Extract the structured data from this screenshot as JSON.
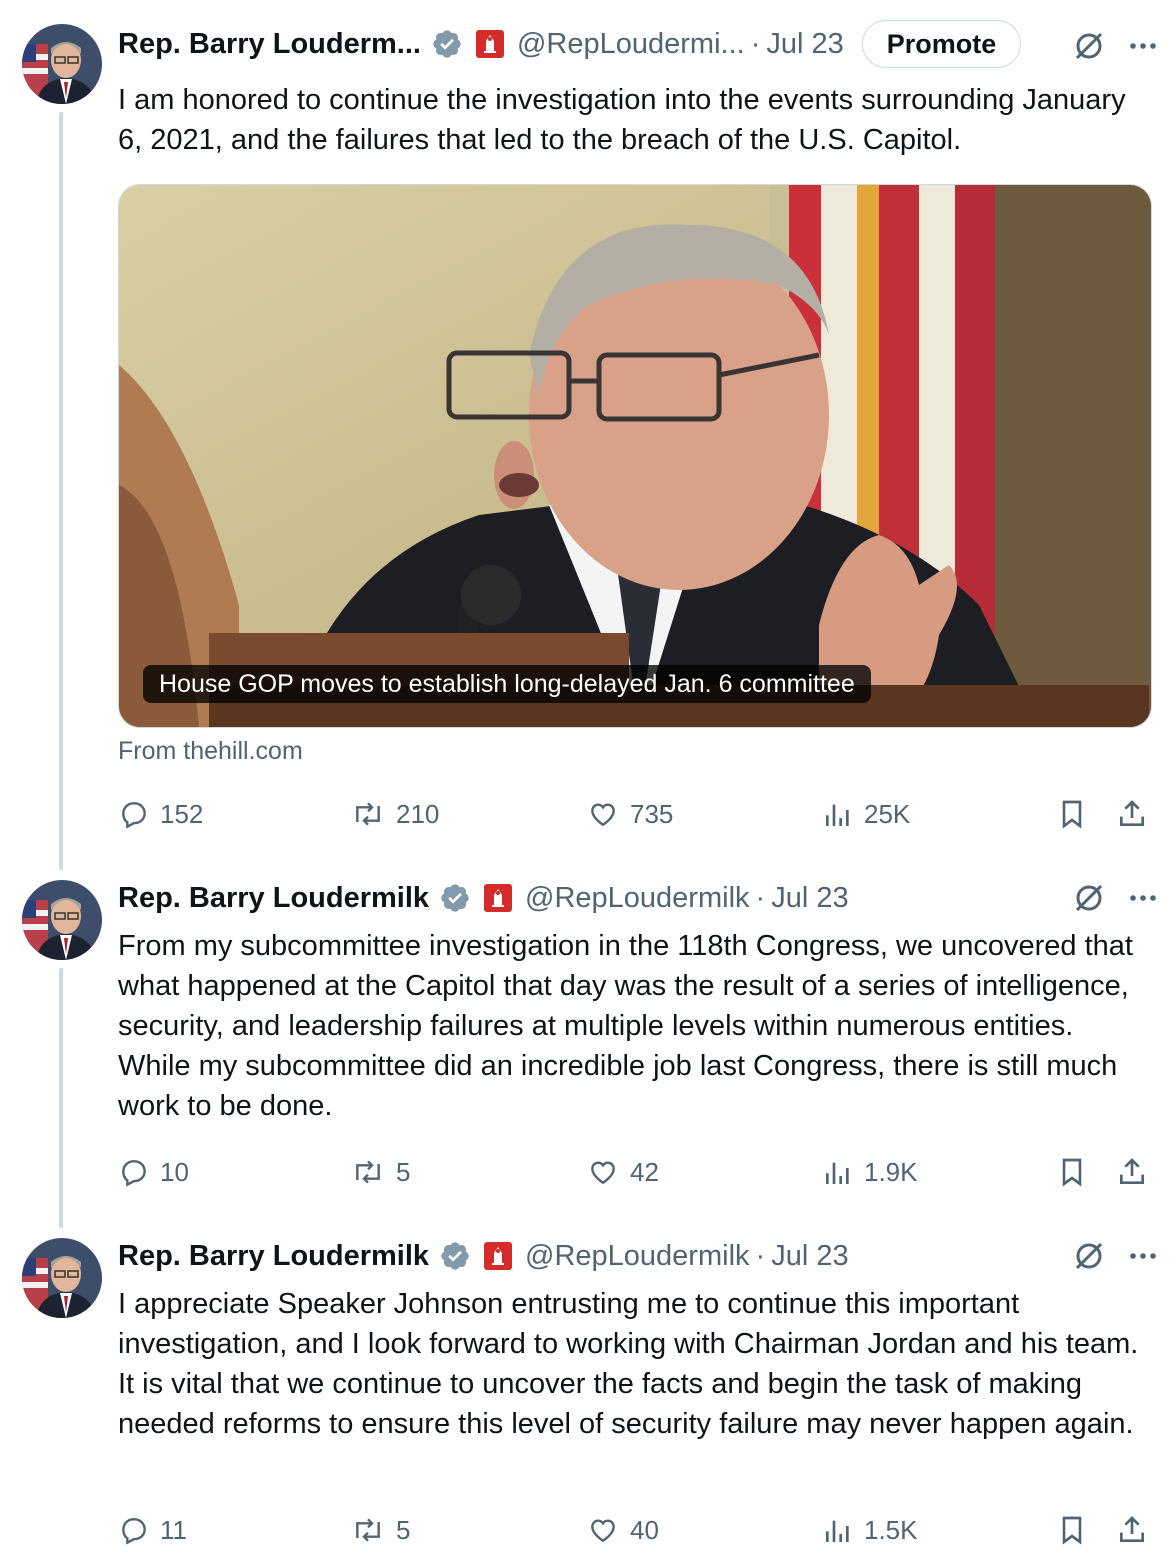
{
  "tweets": [
    {
      "name": "Rep. Barry Louderm...",
      "handle": "@RepLoudermi...",
      "date": "Jul 23",
      "promote_label": "Promote",
      "text": "I am honored to continue the investigation into the events surrounding January 6, 2021, and the failures that led to the breach of the U.S. Capitol.",
      "card": {
        "caption": "House GOP moves to establish long-delayed Jan. 6 committee",
        "source": "From thehill.com"
      },
      "stats": {
        "replies": "152",
        "reposts": "210",
        "likes": "735",
        "views": "25K"
      }
    },
    {
      "name": "Rep. Barry Loudermilk",
      "handle": "@RepLoudermilk",
      "date": "Jul 23",
      "text": "From my subcommittee investigation in the 118th Congress, we uncovered that what happened at the Capitol that day was the result of a series of intelligence, security, and leadership failures at multiple levels within numerous entities. While my subcommittee did an incredible job last Congress, there is still much work to be done.",
      "stats": {
        "replies": "10",
        "reposts": "5",
        "likes": "42",
        "views": "1.9K"
      }
    },
    {
      "name": "Rep. Barry Loudermilk",
      "handle": "@RepLoudermilk",
      "date": "Jul 23",
      "text": "I appreciate Speaker Johnson entrusting me to continue this important investigation, and I look forward to working with Chairman Jordan and his team. It is vital that we continue to uncover the facts and begin the task of making needed reforms to ensure this level of security failure may never happen again.",
      "stats": {
        "replies": "11",
        "reposts": "5",
        "likes": "40",
        "views": "1.5K"
      }
    }
  ],
  "separator": "·",
  "colors": {
    "text": "#0f1419",
    "secondary": "#536471",
    "verified": "#829aab",
    "gov_badge": "#d62b2b",
    "thread_line": "#cfd9de"
  },
  "icons": [
    "verified-badge-icon",
    "government-badge-icon",
    "analytics-icon",
    "more-icon",
    "reply-icon",
    "repost-icon",
    "like-icon",
    "views-icon",
    "bookmark-icon",
    "share-icon"
  ]
}
